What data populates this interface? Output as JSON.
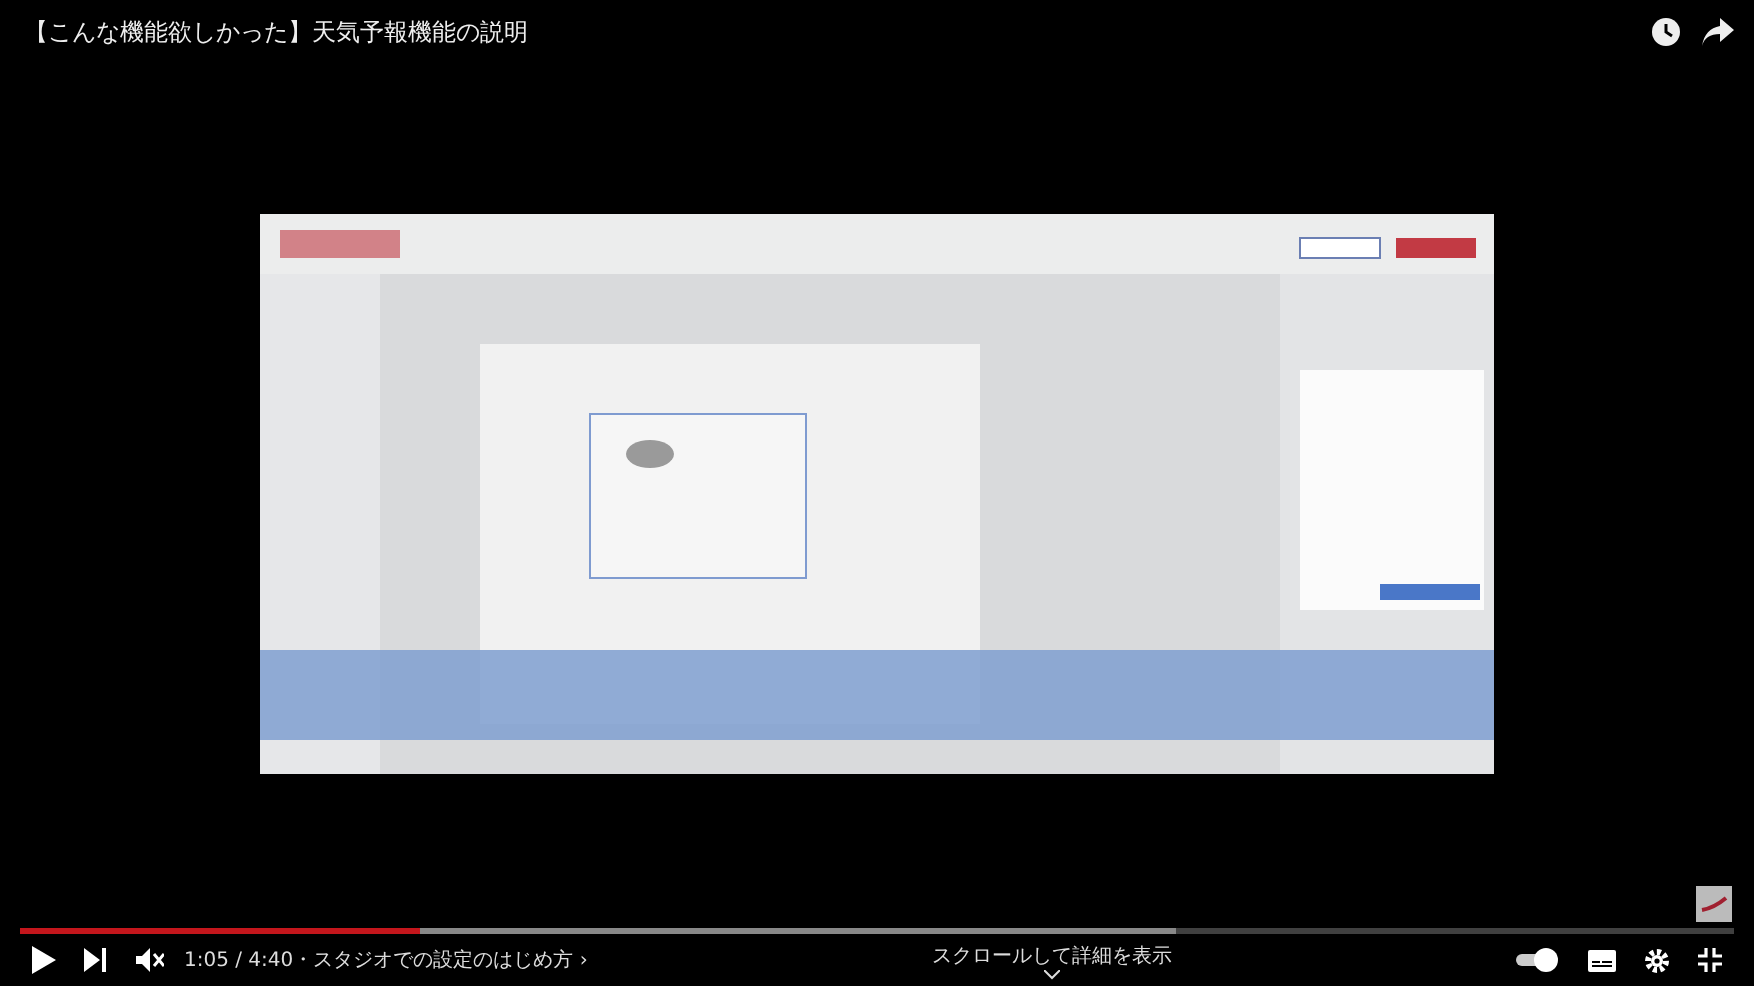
{
  "title": "【こんな機能欲しかった】天気予報機能の説明",
  "player": {
    "time": "1:05 / 4:40",
    "chapter": "・スタジオでの設定のはじめ方 ›",
    "scroll_hint": "スクロールして詳細を表示",
    "muted": true,
    "autoplay": true,
    "progress": {
      "level": 0.233
    },
    "buffered": {
      "level": 0.675
    }
  }
}
